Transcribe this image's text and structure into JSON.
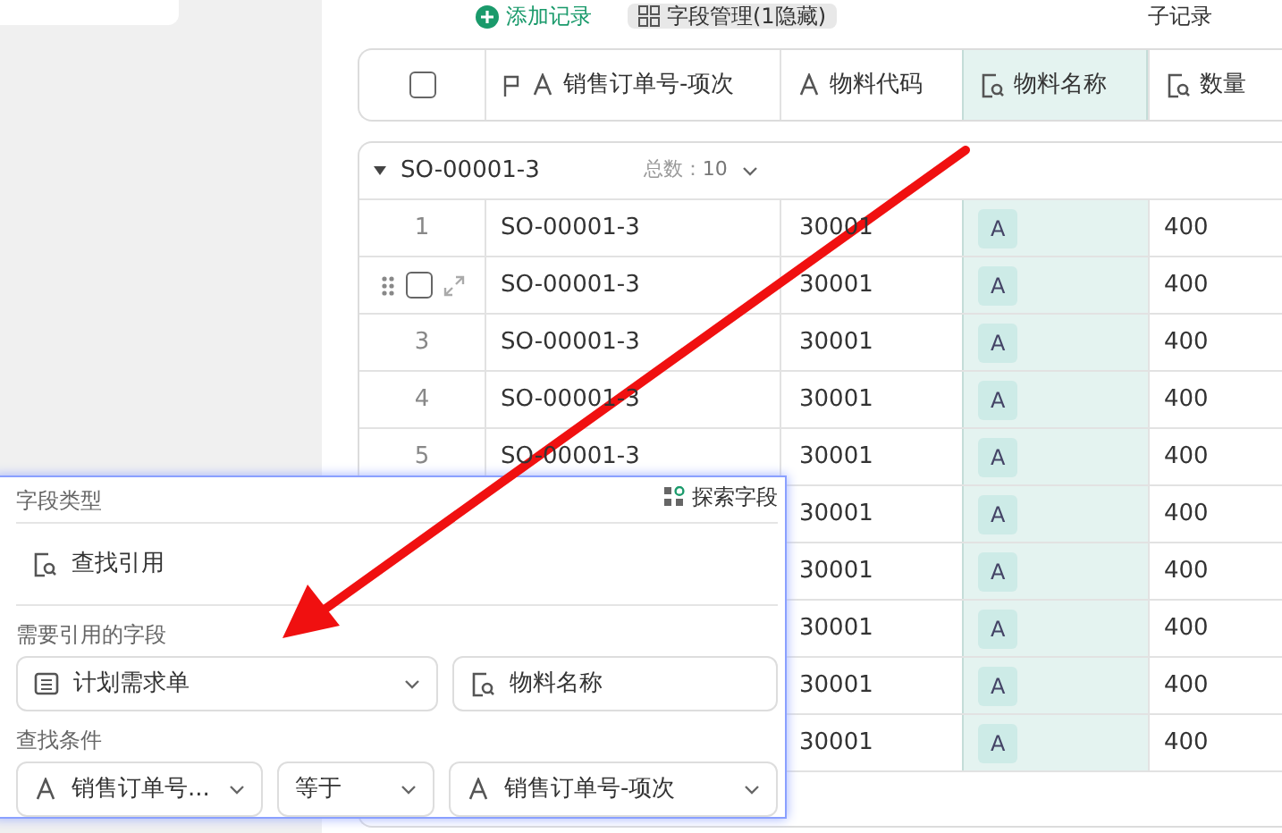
{
  "toolbar": {
    "add_record": "添加记录",
    "field_manager": "字段管理(1隐藏)",
    "sub_record": "子记录"
  },
  "table": {
    "header_checkbox": {
      "checked": false
    },
    "columns": [
      {
        "label": "销售订单号-项次",
        "kind": "text",
        "primary": true,
        "selected": false
      },
      {
        "label": "物料代码",
        "kind": "text",
        "primary": false,
        "selected": false
      },
      {
        "label": "物料名称",
        "kind": "lookup",
        "primary": false,
        "selected": true
      },
      {
        "label": "数量",
        "kind": "lookup",
        "primary": false,
        "selected": false
      }
    ],
    "group": {
      "title": "SO-00001-3",
      "count_label": "总数：",
      "count": "10",
      "expanded": true
    },
    "rows": [
      {
        "index": "1",
        "hovered": false,
        "order_no": "SO-00001-3",
        "material_code": "30001",
        "material_name": "A",
        "quantity": "400"
      },
      {
        "hovered": true,
        "checked": false,
        "order_no": "SO-00001-3",
        "material_code": "30001",
        "material_name": "A",
        "quantity": "400"
      },
      {
        "index": "3",
        "hovered": false,
        "order_no": "SO-00001-3",
        "material_code": "30001",
        "material_name": "A",
        "quantity": "400"
      },
      {
        "index": "4",
        "hovered": false,
        "order_no": "SO-00001-3",
        "material_code": "30001",
        "material_name": "A",
        "quantity": "400"
      },
      {
        "index": "5",
        "hovered": false,
        "order_no": "SO-00001-3",
        "material_code": "30001",
        "material_name": "A",
        "quantity": "400"
      },
      {
        "hovered": false,
        "material_code": "30001",
        "material_name": "A",
        "quantity": "400"
      },
      {
        "hovered": false,
        "material_code": "30001",
        "material_name": "A",
        "quantity": "400"
      },
      {
        "hovered": false,
        "material_code": "30001",
        "material_name": "A",
        "quantity": "400"
      },
      {
        "hovered": false,
        "material_code": "30001",
        "material_name": "A",
        "quantity": "400"
      },
      {
        "hovered": false,
        "material_code": "30001",
        "material_name": "A",
        "quantity": "400"
      }
    ]
  },
  "panel": {
    "field_type_label": "字段类型",
    "explore_link": "探索字段",
    "field_type": "查找引用",
    "ref_label": "需要引用的字段",
    "ref_table": "计划需求单",
    "ref_field": "物料名称",
    "cond_label": "查找条件",
    "cond_field": "销售订单号...",
    "cond_op": "等于",
    "cond_value": "销售订单号-项次"
  }
}
